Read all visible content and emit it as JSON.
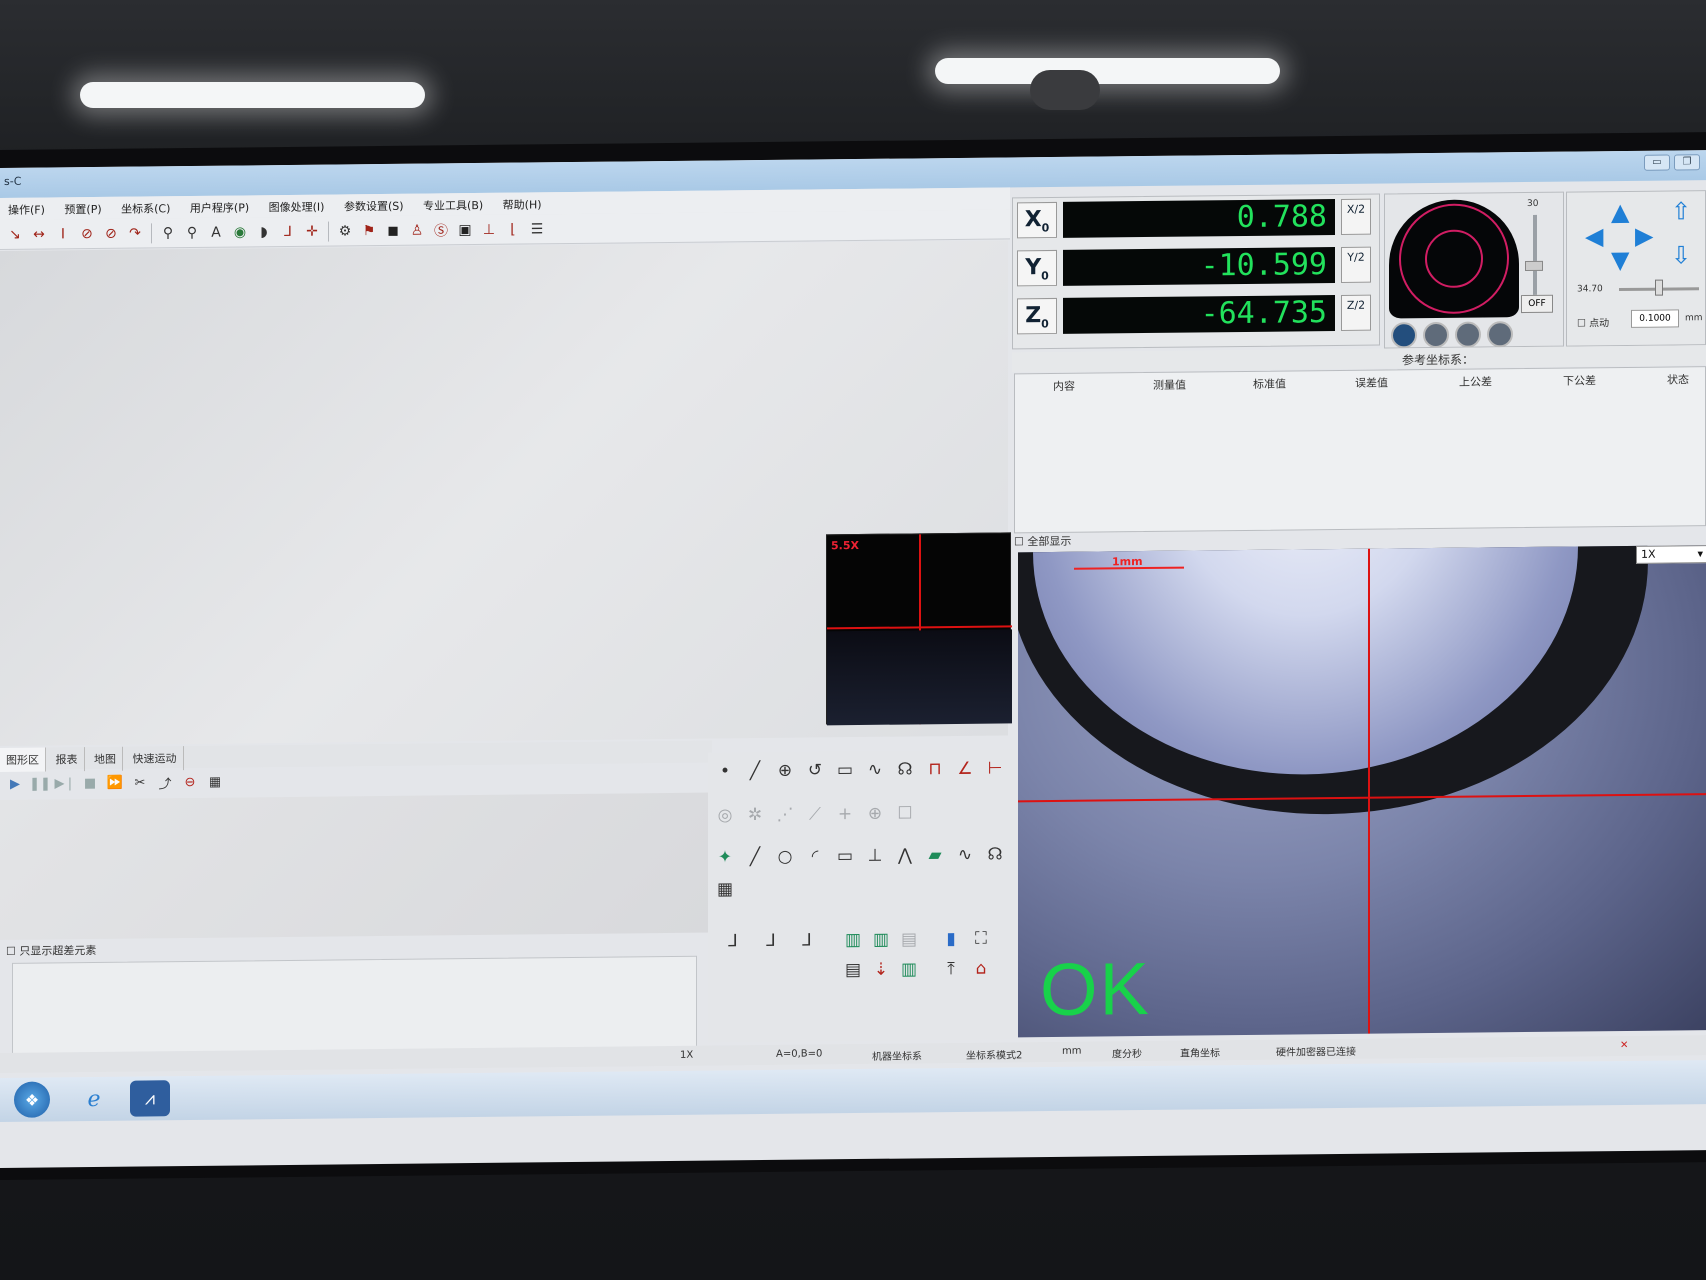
{
  "window": {
    "title": "s-C"
  },
  "menu": [
    "操作(F)",
    "预置(P)",
    "坐标系(C)",
    "用户程序(P)",
    "图像处理(I)",
    "参数设置(S)",
    "专业工具(B)",
    "帮助(H)"
  ],
  "dro": {
    "x_label": "X",
    "y_label": "Y",
    "z_label": "Z",
    "x_value": "0.788",
    "y_value": "-10.599",
    "z_value": "-64.735",
    "x_half": "X/2",
    "y_half": "Y/2",
    "z_half": "Z/2",
    "axis_sub": "0"
  },
  "light_panel": {
    "value_top": "30",
    "off_label": "OFF"
  },
  "motion": {
    "speed_value": "34.70",
    "jog_label": "点动",
    "step_value": "0.1000",
    "unit": "mm"
  },
  "reference_coord_label": "参考坐标系：",
  "result_table": {
    "columns": [
      "内容",
      "测量值",
      "标准值",
      "误差值",
      "上公差",
      "下公差",
      "状态"
    ]
  },
  "show_all_label": "全部显示",
  "camera": {
    "mini_zoom": "5.5X",
    "scale_label": "1mm",
    "zoom_select": "1X",
    "ok_text": "OK"
  },
  "bottom_tabs": [
    "图形区",
    "报表",
    "地图",
    "快速运动"
  ],
  "super_only_label": "只显示超差元素",
  "status": {
    "magnification": "1X",
    "coords": "A=0,B=0",
    "machine_coord": "机器坐标系",
    "coord_mode": "坐标系模式2",
    "unit": "mm",
    "angle": "度分秒",
    "rect": "直角坐标",
    "hw": "硬件加密器已连接"
  },
  "colors": {
    "dro_green": "#22e25c",
    "ok_green": "#18d24a",
    "crosshair": "#d11111"
  }
}
